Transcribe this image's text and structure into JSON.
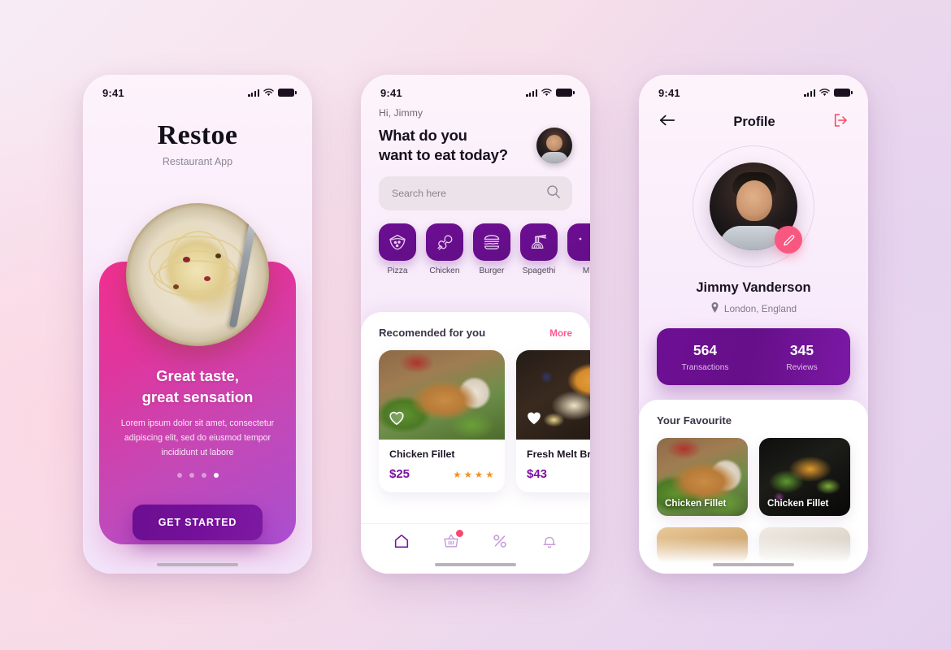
{
  "statusbar": {
    "time": "9:41"
  },
  "screen1": {
    "logo": "Restoe",
    "subtitle": "Restaurant App",
    "headline_line1": "Great taste,",
    "headline_line2": "great sensation",
    "body_line1": "Lorem ipsum dolor sit amet, consectetur",
    "body_line2": "adipiscing elit, sed do eiusmod tempor",
    "body_line3": "incididunt ut labore",
    "dots_total": 4,
    "dots_active_index": 3,
    "cta": "GET STARTED"
  },
  "screen2": {
    "greeting": "Hi, Jimmy",
    "question_line1": "What do you",
    "question_line2": "want to eat today?",
    "search_placeholder": "Search here",
    "search_value": "",
    "categories": [
      {
        "label": "Pizza",
        "icon": "pizza-icon"
      },
      {
        "label": "Chicken",
        "icon": "chicken-leg-icon"
      },
      {
        "label": "Burger",
        "icon": "burger-icon"
      },
      {
        "label": "Spagethi",
        "icon": "spaghetti-icon"
      },
      {
        "label": "M",
        "icon": "more-food-icon"
      }
    ],
    "section_title": "Recomended for you",
    "more_label": "More",
    "foods": [
      {
        "name": "Chicken Fillet",
        "price": "$25",
        "stars": 4,
        "liked": false
      },
      {
        "name": "Fresh Melt Bre",
        "price": "$43",
        "stars": 0,
        "liked": true
      }
    ],
    "tabs": [
      {
        "icon": "home-icon",
        "active": true,
        "badge": false
      },
      {
        "icon": "basket-icon",
        "active": false,
        "badge": true
      },
      {
        "icon": "percent-icon",
        "active": false,
        "badge": false
      },
      {
        "icon": "bell-icon",
        "active": false,
        "badge": false
      }
    ]
  },
  "screen3": {
    "back_icon": "arrow-left-icon",
    "title": "Profile",
    "logout_icon": "logout-icon",
    "edit_icon": "pencil-icon",
    "name": "Jimmy Vanderson",
    "location": "London, England",
    "location_icon": "map-pin-icon",
    "stats": [
      {
        "value": "564",
        "label": "Transactions"
      },
      {
        "value": "345",
        "label": "Reviews"
      }
    ],
    "favourites_title": "Your Favourite",
    "favourites": [
      {
        "name": "Chicken Fillet",
        "img": "chicken"
      },
      {
        "name": "Chicken Fillet",
        "img": "salad"
      },
      {
        "name": "",
        "img": "bread"
      },
      {
        "name": "",
        "img": "rice"
      }
    ]
  },
  "colors": {
    "purple": "#6d0d93",
    "pink": "#f8587f",
    "magenta": "#f0308f",
    "price": "#7b11a4",
    "star": "#f7901e",
    "logout": "#f9485f"
  }
}
